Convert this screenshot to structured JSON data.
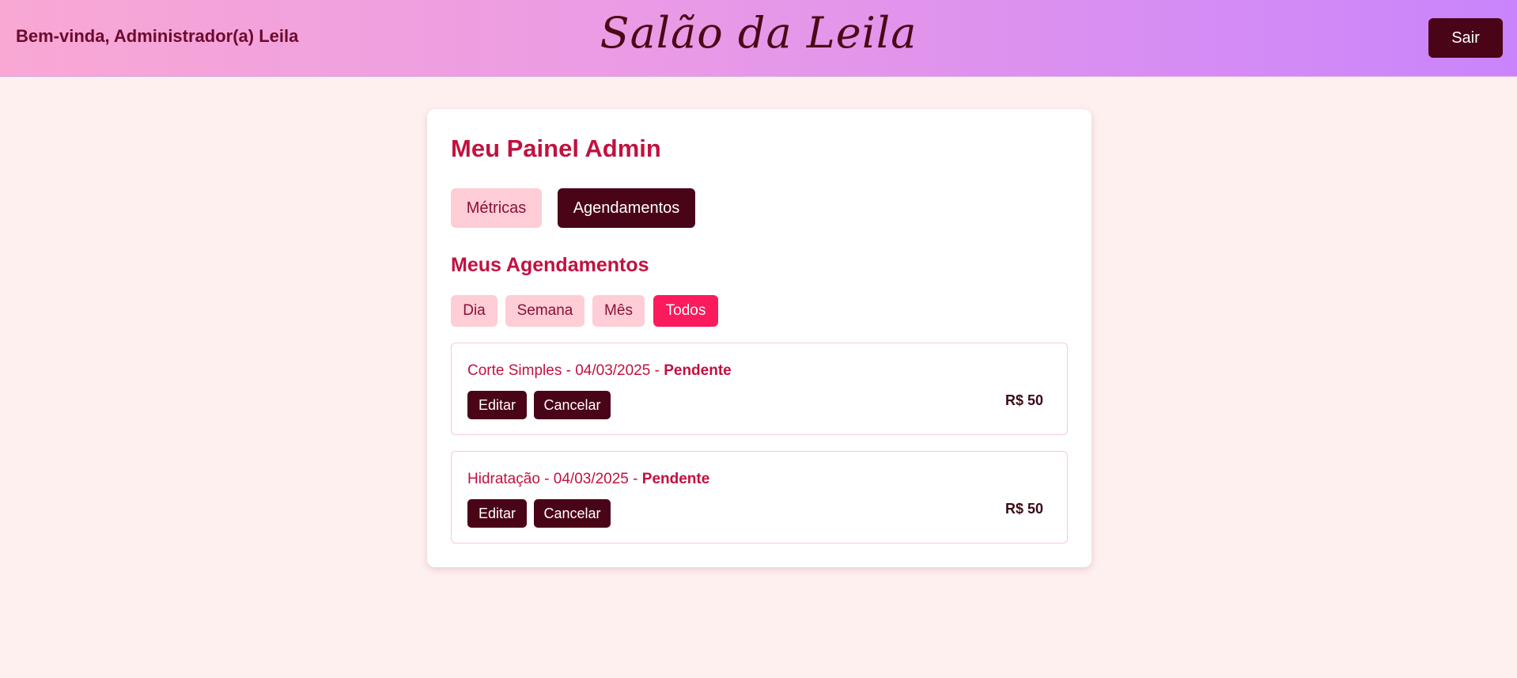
{
  "header": {
    "welcome": "Bem-vinda, Administrador(a) Leila",
    "brand": "Salão da Leila",
    "logout_label": "Sair"
  },
  "panel": {
    "title": "Meu Painel Admin",
    "tabs": [
      {
        "label": "Métricas",
        "active": false
      },
      {
        "label": "Agendamentos",
        "active": true
      }
    ],
    "section_title": "Meus Agendamentos",
    "filters": [
      {
        "label": "Dia",
        "active": false
      },
      {
        "label": "Semana",
        "active": false
      },
      {
        "label": "Mês",
        "active": false
      },
      {
        "label": "Todos",
        "active": true
      }
    ],
    "appointments": [
      {
        "service": "Corte Simples",
        "date": "04/03/2025",
        "separator": " - ",
        "status": "Pendente",
        "price": "R$ 50",
        "edit_label": "Editar",
        "cancel_label": "Cancelar"
      },
      {
        "service": "Hidratação",
        "date": "04/03/2025",
        "separator": " - ",
        "status": "Pendente",
        "price": "R$ 50",
        "edit_label": "Editar",
        "cancel_label": "Cancelar"
      }
    ]
  },
  "colors": {
    "accent": "#c2113f",
    "dark_button": "#4a0418",
    "light_pill": "#fecdd6",
    "active_filter": "#fb1a5b",
    "background": "#fff0f0"
  }
}
